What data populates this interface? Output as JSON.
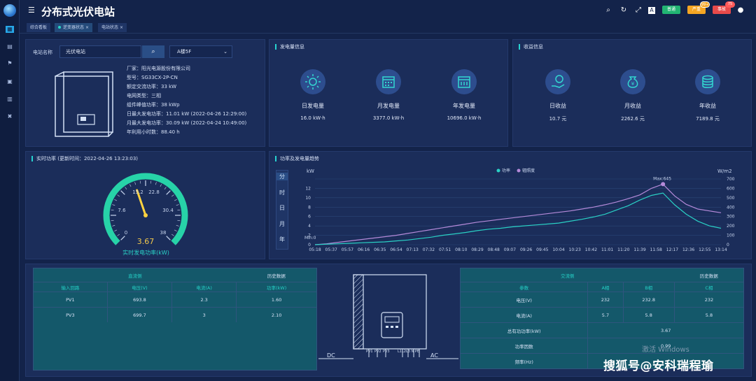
{
  "app": {
    "title": "分布式光伏电站"
  },
  "header": {
    "badges": [
      {
        "label": "普通",
        "color": "#22b573"
      },
      {
        "label": "严重",
        "count": "99+",
        "color": "#f5a623"
      },
      {
        "label": "事故",
        "count": "75",
        "color": "#e84a4a"
      }
    ]
  },
  "tabs": [
    {
      "label": "综合看板",
      "active": false,
      "closable": false
    },
    {
      "label": "逆变器状态",
      "active": true,
      "closable": true
    },
    {
      "label": "电站状态",
      "active": false,
      "closable": true
    }
  ],
  "station": {
    "name_label": "电站名称",
    "name_value": "光伏电站",
    "building_select": "A楼5F",
    "info": [
      "厂家：阳光电源股份有限公司",
      "型号：SG33CX-2P-CN",
      "额定交流功率：33 kW",
      "电网类型：三相",
      "组件峰值功率：38 kWp",
      "日最大发电功率：11.01 kW (2022-04-26 12:29:00)",
      "月最大发电功率：30.09 kW (2022-04-24 10:49:00)",
      "年利用小时数：88.40 h"
    ]
  },
  "generation": {
    "title": "发电量信息",
    "items": [
      {
        "label": "日发电量",
        "value": "16.0 kW·h"
      },
      {
        "label": "月发电量",
        "value": "3377.0 kW·h"
      },
      {
        "label": "年发电量",
        "value": "10696.0 kW·h"
      }
    ]
  },
  "revenue": {
    "title": "收益信息",
    "items": [
      {
        "label": "日收益",
        "value": "10.7 元"
      },
      {
        "label": "月收益",
        "value": "2262.6 元"
      },
      {
        "label": "年收益",
        "value": "7189.8 元"
      }
    ]
  },
  "realtime": {
    "title": "实时功率 (更新时间：2022-04-26 13:23:03)",
    "value": 3.67,
    "value_text": "3.67",
    "max": 38,
    "ticks": [
      "0",
      "7.6",
      "15.2",
      "22.8",
      "30.4",
      "38"
    ],
    "caption": "实时发电功率(kW)"
  },
  "trend": {
    "title": "功率及发电量趋势",
    "periods": [
      "分",
      "时",
      "日",
      "月",
      "年"
    ],
    "active_period": "分"
  },
  "chart_data": {
    "type": "line",
    "ylabel_left": "kW",
    "ylabel_right": "W/m2",
    "ylim_left": [
      0,
      14
    ],
    "ylim_right": [
      0,
      700
    ],
    "y_ticks_left": [
      "0",
      "2",
      "4",
      "6",
      "8",
      "10",
      "12"
    ],
    "y_ticks_right": [
      "0",
      "100",
      "200",
      "300",
      "400",
      "500",
      "600",
      "700"
    ],
    "x_ticks": [
      "05:18",
      "05:37",
      "05:57",
      "06:16",
      "06:35",
      "06:54",
      "07:13",
      "07:32",
      "07:51",
      "08:10",
      "08:29",
      "08:48",
      "09:07",
      "09:26",
      "09:45",
      "10:04",
      "10:23",
      "10:42",
      "11:01",
      "11:20",
      "11:39",
      "11:58",
      "12:17",
      "12:36",
      "12:55",
      "13:14"
    ],
    "legend": [
      "功率",
      "辐照度"
    ],
    "legend_position": "top-center",
    "annotations": [
      "Min:0",
      "Max:645"
    ],
    "series": [
      {
        "name": "功率",
        "axis": "left",
        "color": "#2ad1c5",
        "values": [
          0,
          0.1,
          0.2,
          0.3,
          0.4,
          0.5,
          0.6,
          0.8,
          1.0,
          1.3,
          1.6,
          2.0,
          2.3,
          2.6,
          3.0,
          3.3,
          3.5,
          3.8,
          4.0,
          4.2,
          4.4,
          4.6,
          5.0,
          5.4,
          5.9,
          6.5,
          7.4,
          8.3,
          9.5,
          10.5,
          11.0,
          8.5,
          6.5,
          5.0,
          4.0,
          3.5
        ]
      },
      {
        "name": "辐照度",
        "axis": "right",
        "color": "#b58ad9",
        "values": [
          0,
          10,
          25,
          40,
          55,
          70,
          85,
          100,
          120,
          140,
          160,
          180,
          200,
          220,
          240,
          255,
          270,
          285,
          300,
          315,
          330,
          345,
          360,
          380,
          400,
          425,
          455,
          490,
          530,
          600,
          645,
          520,
          430,
          380,
          360,
          340
        ]
      }
    ]
  },
  "dc_table": {
    "caption": "直流侧",
    "history": "历史数据",
    "headers": [
      "输入回路",
      "电压(V)",
      "电流(A)",
      "功率(kW)"
    ],
    "rows": [
      [
        "PV1",
        "693.8",
        "2.3",
        "1.60"
      ],
      [
        "PV3",
        "699.7",
        "3",
        "2.10"
      ]
    ]
  },
  "ac_table": {
    "caption": "交流侧",
    "history": "历史数据",
    "headers": [
      "参数",
      "A相",
      "B相",
      "C相"
    ],
    "rows": [
      [
        "电压(V)",
        "232",
        "232.8",
        "232"
      ],
      [
        "电流(A)",
        "5.7",
        "5.8",
        "5.8"
      ]
    ],
    "total_power_label": "总有功功率(kW)",
    "total_power_value": "3.67",
    "pf_label": "功率因数",
    "pf_value": "0.99",
    "freq_label": "频率(Hz)",
    "freq_value": ""
  },
  "diagram": {
    "dc": "DC",
    "ac": "AC",
    "dc_ports": [
      "PV1",
      "PV2",
      "PV3"
    ],
    "ac_ports": "L1L2L3 N PE"
  },
  "overlay": {
    "activation": "激活 Windows",
    "watermark": "搜狐号@安科瑞程瑜"
  }
}
